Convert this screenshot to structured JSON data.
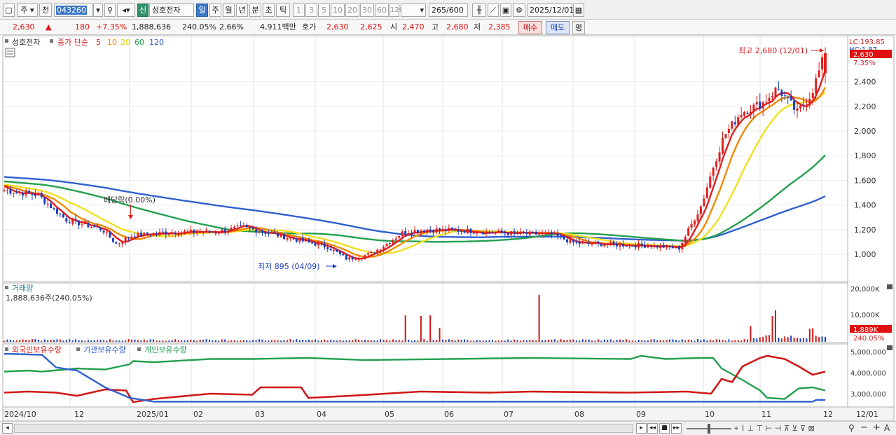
{
  "toolbar": {
    "market": "주",
    "all_btn": "전",
    "stock_code": "043260",
    "credit_badge": "신",
    "stock_name": "성호전자",
    "periods": [
      "일",
      "주",
      "월",
      "년",
      "분",
      "초",
      "틱"
    ],
    "selected_period": "일",
    "intervals": [
      "1",
      "3",
      "5",
      "10",
      "20",
      "30",
      "60",
      "120"
    ],
    "count_value": "265",
    "count_total": "/600",
    "date_value": "2025/12/01"
  },
  "quote": {
    "price": "2,630",
    "change_arrow": "▲",
    "change": "180",
    "change_pct": "+7.35%",
    "volume": "1,888,636",
    "volume_ratio": "240.05%",
    "turnover_pct": "2.66%",
    "amount": "4,911백만",
    "label_hoga": "호가",
    "ask": "2,630",
    "bid": "2,625",
    "label_open": "시",
    "open": "2,470",
    "label_high": "고",
    "high": "2,680",
    "label_low": "저",
    "low": "2,385",
    "buy_btn": "매수",
    "sell_btn": "매도",
    "eval_btn": "평"
  },
  "price_panel": {
    "legend_name": "성호전자",
    "legend_ma": "종가 단순",
    "ma_periods": [
      "5",
      "10",
      "20",
      "60",
      "120"
    ],
    "ma_colors": [
      "#e02020",
      "#f08a00",
      "#f0e020",
      "#23a050",
      "#3060d0"
    ],
    "lc_label": "LC:193.85",
    "hc_label": "HC:1.87",
    "price_badge": "2,630",
    "pct_badge": "7.35%",
    "y_ticks": [
      "2,400",
      "2,200",
      "2,000",
      "1,800",
      "1,600",
      "1,400",
      "1,200",
      "1,000"
    ],
    "annotation_high": "최고 2,680 (12/01)",
    "annotation_low": "최저 895 (04/09)",
    "annotation_dividend": "배당락(0.00%)"
  },
  "volume_panel": {
    "title": "거래량",
    "value": "1,888,636주(240.05%)",
    "y_ticks": [
      "20,000K",
      "10,000K"
    ],
    "badge_value": "1,889K",
    "badge_pct": "240.05%"
  },
  "holdings_panel": {
    "legend": [
      "외국인보유수량",
      "기관보유수량",
      "개인보유수량"
    ],
    "legend_colors": [
      "#e02020",
      "#3060d0",
      "#23a050"
    ],
    "y_ticks": [
      "5,000,000",
      "4,000,000",
      "3,000,000"
    ]
  },
  "x_axis": {
    "labels": [
      "2024/10",
      "12",
      "2025/01",
      "02",
      "03",
      "04",
      "05",
      "06",
      "07",
      "08",
      "09",
      "10",
      "11",
      "12",
      "12/01"
    ]
  },
  "chart_data": {
    "type": "candlestick",
    "period": "daily",
    "x_range": [
      "2024/10",
      "2025/12/01"
    ],
    "ylim": [
      850,
      2750
    ],
    "last_candle": {
      "date": "12/01",
      "open": 2470,
      "high": 2680,
      "low": 2385,
      "close": 2630
    },
    "period_high": {
      "value": 2680,
      "date": "12/01"
    },
    "period_low": {
      "value": 895,
      "date": "04/09"
    },
    "price_path_approx": [
      {
        "x": "2024/10",
        "y": 1520
      },
      {
        "x": "11",
        "y": 1280
      },
      {
        "x": "12",
        "y": 1150
      },
      {
        "x": "2025/01",
        "y": 1180
      },
      {
        "x": "02",
        "y": 1170
      },
      {
        "x": "03",
        "y": 1220
      },
      {
        "x": "04",
        "y": 960
      },
      {
        "x": "05",
        "y": 1180
      },
      {
        "x": "06",
        "y": 1190
      },
      {
        "x": "07",
        "y": 1150
      },
      {
        "x": "08",
        "y": 1080
      },
      {
        "x": "09",
        "y": 1060
      },
      {
        "x": "10",
        "y": 1200
      },
      {
        "x": "10 mid",
        "y": 1900
      },
      {
        "x": "11",
        "y": 2150
      },
      {
        "x": "12",
        "y": 2630
      }
    ],
    "moving_averages": [
      {
        "name": "5",
        "last": 2380
      },
      {
        "name": "10",
        "last": 2280
      },
      {
        "name": "20",
        "last": 2220
      },
      {
        "name": "60",
        "last": 1600
      },
      {
        "name": "120",
        "last": 1360
      }
    ],
    "volume_last": 1888636,
    "holdings_last": {
      "외국인보유수량": 4050000,
      "기관보유수량": 2600000,
      "개인보유수량": 3150000
    }
  }
}
